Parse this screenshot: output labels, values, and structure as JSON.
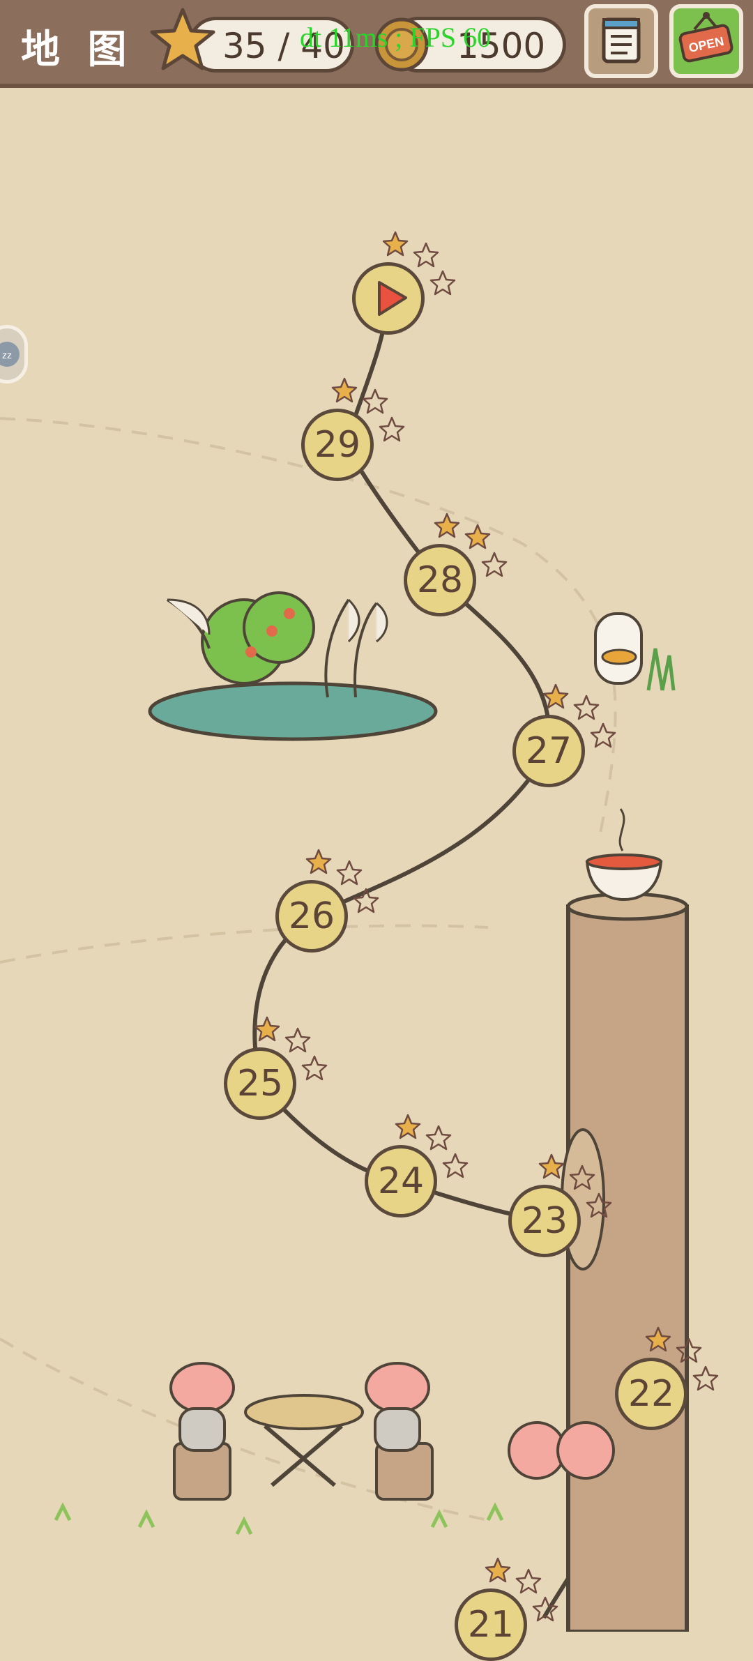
{
  "header": {
    "map_title": "地 图",
    "stars_value": "35 / 40",
    "coins_value": "1500",
    "fps_overlay": "dt 11ms ; FPS 60",
    "open_sign_label": "OPEN"
  },
  "levels": [
    {
      "label": "",
      "current": true,
      "stars_earned": 1
    },
    {
      "label": "29",
      "stars_earned": 1
    },
    {
      "label": "28",
      "stars_earned": 2
    },
    {
      "label": "27",
      "stars_earned": 1
    },
    {
      "label": "26",
      "stars_earned": 1
    },
    {
      "label": "25",
      "stars_earned": 1
    },
    {
      "label": "24",
      "stars_earned": 1
    },
    {
      "label": "23",
      "stars_earned": 1
    },
    {
      "label": "22",
      "stars_earned": 1
    },
    {
      "label": "21",
      "stars_earned": 1
    }
  ],
  "colors": {
    "header_bg": "#8c6e5c",
    "map_bg": "#e6d7b8",
    "level_fill": "#e8d486",
    "star_gold": "#e8b04a",
    "open_sign_bg": "#7cc04e",
    "play_red": "#e8523e"
  },
  "icons": {
    "stars": "star-icon",
    "coins": "coin-icon",
    "journal": "notebook-icon",
    "shop": "open-sign-icon",
    "side": "zz-sleep-icon"
  }
}
